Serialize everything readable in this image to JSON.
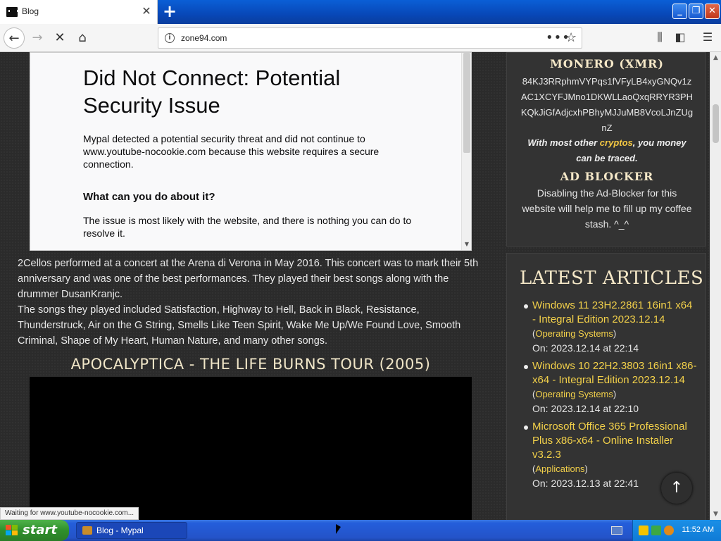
{
  "browser": {
    "tab_title": "Blog",
    "url": "zone94.com",
    "status_text": "Waiting for www.youtube-nocookie.com..."
  },
  "error_frame": {
    "title": "Did Not Connect: Potential Security Issue",
    "description": "Mypal detected a potential security threat and did not continue to www.youtube-nocookie.com because this website requires a secure connection.",
    "subheading": "What can you do about it?",
    "help": "The issue is most likely with the website, and there is nothing you can do to resolve it."
  },
  "article": {
    "paragraph1": "2Cellos performed at a concert at the Arena di Verona in May 2016. This concert was to mark their 5th anniversary and was one of the best performances. They played their best songs along with the drummer DusanKranjc.",
    "paragraph2": "The songs they played included Satisfaction, Highway to Hell, Back in Black, Resistance, Thunderstruck, Air on the G String, Smells Like Teen Spirit, Wake Me Up/We Found Love, Smooth Criminal, Shape of My Heart, Human Nature, and many other songs.",
    "section_heading": "APOCALYPTICA - THE LIFE BURNS TOUR (2005)"
  },
  "sidebar": {
    "monero_heading": "MONERO (XMR)",
    "monero_address": "84KJ3RRphmVYPqs1fVFyLB4xyGNQv1zAC1XCYFJMno1DKWLLaoQxqRRYR3PHKQkJiGfAdjcxhPBhyMJJuMB8VcoLJnZUgnZ",
    "note_before": "With most other ",
    "note_highlight": "cryptos",
    "note_after": ", you money can be traced.",
    "adblock_heading": "AD BLOCKER",
    "adblock_text": "Disabling the Ad-Blocker for this website will help me to fill up my coffee stash. ^_^",
    "latest_heading": "LATEST ARTICLES",
    "articles": [
      {
        "title": "Windows 11 23H2.2861 16in1 x64 - Integral Edition 2023.12.14",
        "category": "Operating Systems",
        "date": "On: 2023.12.14 at 22:14"
      },
      {
        "title": "Windows 10 22H2.3803 16in1 x86-x64 - Integral Edition 2023.12.14",
        "category": "Operating Systems",
        "date": "On: 2023.12.14 at 22:10"
      },
      {
        "title": "Microsoft Office 365 Professional Plus x86-x64 - Online Installer v3.2.3",
        "category": "Applications",
        "date": "On: 2023.12.13 at 22:41"
      }
    ]
  },
  "taskbar": {
    "start_label": "start",
    "task_label": "Blog - Mypal",
    "clock": "11:52 AM"
  },
  "colors": {
    "page_bg": "#2b2b2b",
    "link_yellow": "#f2d04a",
    "heading_cream": "#f5e8c8",
    "xp_blue": "#245edb",
    "start_green": "#2f8f2c"
  }
}
